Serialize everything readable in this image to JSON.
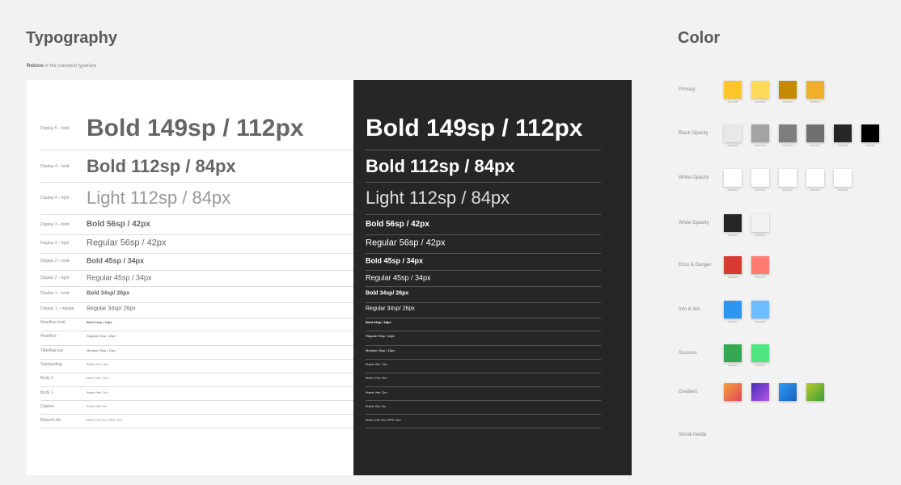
{
  "typography": {
    "title": "Typography",
    "subtitle_bold": "Roboto",
    "subtitle_rest": " is the standard typeface",
    "rows": [
      {
        "label": "Display 5 – bold",
        "sample": "Bold 149sp / 112px"
      },
      {
        "label": "Display 4 – bold",
        "sample": "Bold 112sp / 84px"
      },
      {
        "label": "Display 4 – light",
        "sample": "Light 112sp / 84px"
      },
      {
        "label": "Display 3 – bold",
        "sample": "Bold 56sp / 42px"
      },
      {
        "label": "Display 3 – light",
        "sample": "Regular 56sp / 42px"
      },
      {
        "label": "Display 2 – bold",
        "sample": "Bold 45sp / 34px"
      },
      {
        "label": "Display 2 – light",
        "sample": "Regular 45sp / 34px"
      },
      {
        "label": "Display 1 – bold",
        "sample": "Bold 34sp/ 26px"
      },
      {
        "label": "Display 1 – regular",
        "sample": "Regular 34sp/ 26px"
      },
      {
        "label": "Headline bold",
        "sample": "Bold 24sp / 18px"
      },
      {
        "label": "Headline",
        "sample": "Regular 24sp / 18px"
      },
      {
        "label": "Title/App bar",
        "sample": "Medium 20sp / 15px"
      },
      {
        "label": "Subheading",
        "sample": "Regular 16sp / 12px"
      },
      {
        "label": "Body 2",
        "sample": "Medium 14sp / 11px"
      },
      {
        "label": "Body 1",
        "sample": "Regular 14sp / 11px"
      },
      {
        "label": "Caption",
        "sample": "Regular 12sp / 9px"
      },
      {
        "label": "Button/Link",
        "sample": "Medium 14sp (ALL CAPS) / 11px"
      }
    ]
  },
  "color": {
    "title": "Color",
    "groups": [
      {
        "label": "Primary",
        "swatches": [
          {
            "hex": "#FFC62B"
          },
          {
            "hex": "#FFD95A"
          },
          {
            "hex": "#C68A00"
          },
          {
            "hex": "#F0B12A"
          }
        ]
      },
      {
        "label": "Black Opacity",
        "swatches": [
          {
            "hex": "#E8E8E8"
          },
          {
            "hex": "#A3A3A3"
          },
          {
            "hex": "#7E7E7E"
          },
          {
            "hex": "#707070"
          },
          {
            "hex": "#262626"
          },
          {
            "hex": "#000000"
          }
        ]
      },
      {
        "label": "White Opacity",
        "swatches": [
          {
            "hex": "#FFFFFF"
          },
          {
            "hex": "#FFFFFF"
          },
          {
            "hex": "#FFFFFF"
          },
          {
            "hex": "#FFFFFF"
          },
          {
            "hex": "#FFFFFF"
          }
        ]
      },
      {
        "label": "White Opacity",
        "swatches": [
          {
            "hex": "#262626"
          },
          {
            "hex": "#F2F2F2"
          }
        ]
      },
      {
        "label": "Error & Danger",
        "swatches": [
          {
            "hex": "#D83A34"
          },
          {
            "hex": "#FF7A70"
          }
        ]
      },
      {
        "label": "Info & link",
        "swatches": [
          {
            "hex": "#2F96F0"
          },
          {
            "hex": "#6CBCFF"
          }
        ]
      },
      {
        "label": "Success",
        "swatches": [
          {
            "hex": "#34A853"
          },
          {
            "hex": "#4FE57F"
          }
        ]
      },
      {
        "label": "Gradient",
        "swatches": [
          {
            "hex": "#F2A03A",
            "hex2": "#E2485A"
          },
          {
            "hex": "#4A2BC0",
            "hex2": "#B35BE0"
          },
          {
            "hex": "#2C9CF5",
            "hex2": "#1B5FC0"
          },
          {
            "hex": "#B8CC2A",
            "hex2": "#3C9E3A"
          }
        ]
      },
      {
        "label": "Social media",
        "swatches": []
      }
    ]
  }
}
